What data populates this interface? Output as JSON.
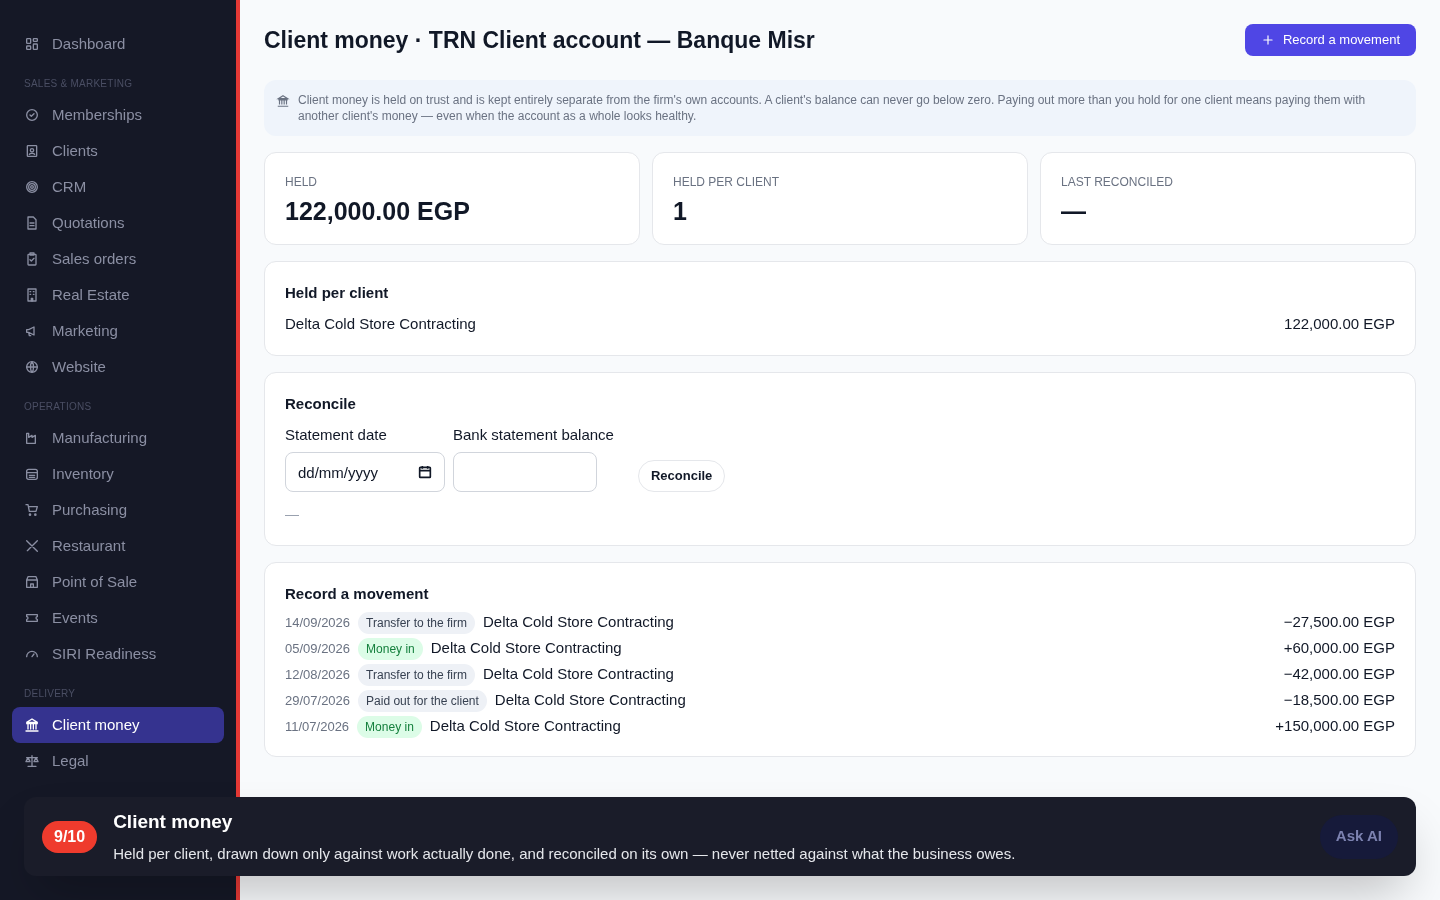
{
  "sidebar": {
    "top_items": [
      {
        "label": "Dashboard",
        "selected": false
      }
    ],
    "sections": [
      {
        "title": "SALES & MARKETING",
        "items": [
          {
            "label": "Memberships",
            "selected": false
          },
          {
            "label": "Clients",
            "selected": false
          },
          {
            "label": "CRM",
            "selected": false
          },
          {
            "label": "Quotations",
            "selected": false
          },
          {
            "label": "Sales orders",
            "selected": false
          },
          {
            "label": "Real Estate",
            "selected": false
          },
          {
            "label": "Marketing",
            "selected": false
          },
          {
            "label": "Website",
            "selected": false
          }
        ]
      },
      {
        "title": "OPERATIONS",
        "items": [
          {
            "label": "Manufacturing",
            "selected": false
          },
          {
            "label": "Inventory",
            "selected": false
          },
          {
            "label": "Purchasing",
            "selected": false
          },
          {
            "label": "Restaurant",
            "selected": false
          },
          {
            "label": "Point of Sale",
            "selected": false
          },
          {
            "label": "Events",
            "selected": false
          },
          {
            "label": "SIRI Readiness",
            "selected": false
          }
        ]
      },
      {
        "title": "DELIVERY",
        "items": [
          {
            "label": "Client money",
            "selected": true
          },
          {
            "label": "Legal",
            "selected": false
          }
        ]
      }
    ]
  },
  "page": {
    "title": "Client money · TRN Client account — Banque Misr",
    "primary_button": "Record a movement",
    "notice": "Client money is held on trust and is kept entirely separate from the firm's own accounts. A client's balance can never go below zero. Paying out more than you hold for one client means paying them with another client's money — even when the account as a whole looks healthy.",
    "stats": [
      {
        "label": "HELD",
        "value": "122,000.00 EGP"
      },
      {
        "label": "HELD PER CLIENT",
        "value": "1"
      },
      {
        "label": "LAST RECONCILED",
        "value": "—"
      }
    ],
    "held_per_client": {
      "title": "Held per client",
      "rows": [
        {
          "client": "Delta Cold Store Contracting",
          "amount": "122,000.00 EGP"
        }
      ]
    },
    "reconcile": {
      "title": "Reconcile",
      "date_label": "Statement date",
      "date_placeholder": "dd/mm/yyyy",
      "balance_label": "Bank statement balance",
      "button": "Reconcile",
      "result": "—"
    },
    "movements": {
      "title": "Record a movement",
      "rows": [
        {
          "date": "14/09/2026",
          "kind": "out",
          "tag": "Transfer to the firm",
          "client": "Delta Cold Store Contracting",
          "amount": "−27,500.00 EGP"
        },
        {
          "date": "05/09/2026",
          "kind": "in",
          "tag": "Money in",
          "client": "Delta Cold Store Contracting",
          "amount": "+60,000.00 EGP"
        },
        {
          "date": "12/08/2026",
          "kind": "out",
          "tag": "Transfer to the firm",
          "client": "Delta Cold Store Contracting",
          "amount": "−42,000.00 EGP"
        },
        {
          "date": "29/07/2026",
          "kind": "out",
          "tag": "Paid out for the client",
          "client": "Delta Cold Store Contracting",
          "amount": "−18,500.00 EGP"
        },
        {
          "date": "11/07/2026",
          "kind": "in",
          "tag": "Money in",
          "client": "Delta Cold Store Contracting",
          "amount": "+150,000.00 EGP"
        }
      ]
    }
  },
  "tour": {
    "step": "9/10",
    "title": "Client money",
    "text": "Held per client, drawn down only against work actually done, and reconciled on its own — never netted against what the business owes.",
    "ask_button": "Ask AI"
  }
}
